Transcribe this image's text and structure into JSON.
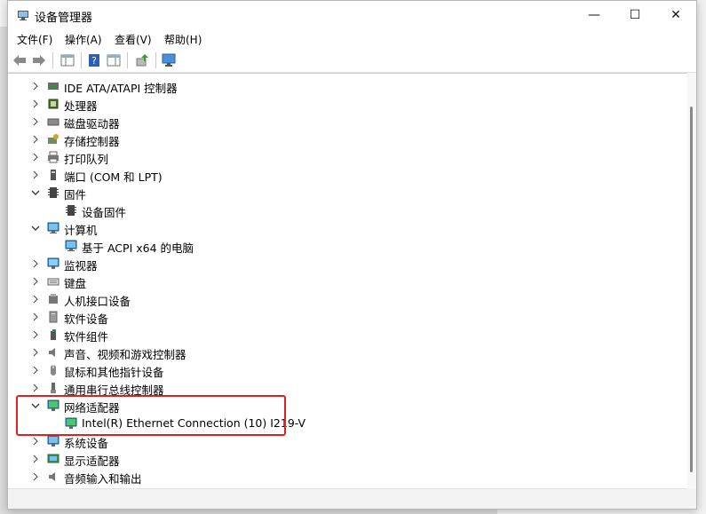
{
  "window": {
    "title": "设备管理器"
  },
  "menu": [
    "文件(F)",
    "操作(A)",
    "查看(V)",
    "帮助(H)"
  ],
  "window_controls": {
    "minimize": "—",
    "maximize": "☐",
    "close": "✕"
  },
  "tree": [
    {
      "label": "IDE ATA/ATAPI 控制器",
      "level": 0,
      "state": "collapsed",
      "icon": "ide-controller-icon"
    },
    {
      "label": "处理器",
      "level": 0,
      "state": "collapsed",
      "icon": "processor-icon"
    },
    {
      "label": "磁盘驱动器",
      "level": 0,
      "state": "collapsed",
      "icon": "disk-drive-icon"
    },
    {
      "label": "存储控制器",
      "level": 0,
      "state": "collapsed",
      "icon": "storage-controller-icon"
    },
    {
      "label": "打印队列",
      "level": 0,
      "state": "collapsed",
      "icon": "printer-icon"
    },
    {
      "label": "端口 (COM 和 LPT)",
      "level": 0,
      "state": "collapsed",
      "icon": "port-icon"
    },
    {
      "label": "固件",
      "level": 0,
      "state": "expanded",
      "icon": "firmware-icon"
    },
    {
      "label": "设备固件",
      "level": 1,
      "state": "leaf",
      "icon": "firmware-icon"
    },
    {
      "label": "计算机",
      "level": 0,
      "state": "expanded",
      "icon": "computer-icon"
    },
    {
      "label": "基于 ACPI x64 的电脑",
      "level": 1,
      "state": "leaf",
      "icon": "computer-icon"
    },
    {
      "label": "监视器",
      "level": 0,
      "state": "collapsed",
      "icon": "monitor-icon"
    },
    {
      "label": "键盘",
      "level": 0,
      "state": "collapsed",
      "icon": "keyboard-icon"
    },
    {
      "label": "人机接口设备",
      "level": 0,
      "state": "collapsed",
      "icon": "hid-icon"
    },
    {
      "label": "软件设备",
      "level": 0,
      "state": "collapsed",
      "icon": "software-device-icon"
    },
    {
      "label": "软件组件",
      "level": 0,
      "state": "collapsed",
      "icon": "software-component-icon"
    },
    {
      "label": "声音、视频和游戏控制器",
      "level": 0,
      "state": "collapsed",
      "icon": "speaker-icon"
    },
    {
      "label": "鼠标和其他指针设备",
      "level": 0,
      "state": "collapsed",
      "icon": "mouse-icon"
    },
    {
      "label": "通用串行总线控制器",
      "level": 0,
      "state": "collapsed",
      "icon": "usb-icon"
    },
    {
      "label": "网络适配器",
      "level": 0,
      "state": "expanded",
      "icon": "network-adapter-icon"
    },
    {
      "label": "Intel(R) Ethernet Connection (10) I219-V",
      "level": 1,
      "state": "leaf",
      "icon": "network-adapter-icon"
    },
    {
      "label": "系统设备",
      "level": 0,
      "state": "collapsed",
      "icon": "system-device-icon"
    },
    {
      "label": "显示适配器",
      "level": 0,
      "state": "collapsed",
      "icon": "display-adapter-icon"
    },
    {
      "label": "音频输入和输出",
      "level": 0,
      "state": "collapsed",
      "icon": "audio-io-icon"
    }
  ],
  "colors": {
    "highlight": "#e02020",
    "accent": "#1a73c7"
  }
}
